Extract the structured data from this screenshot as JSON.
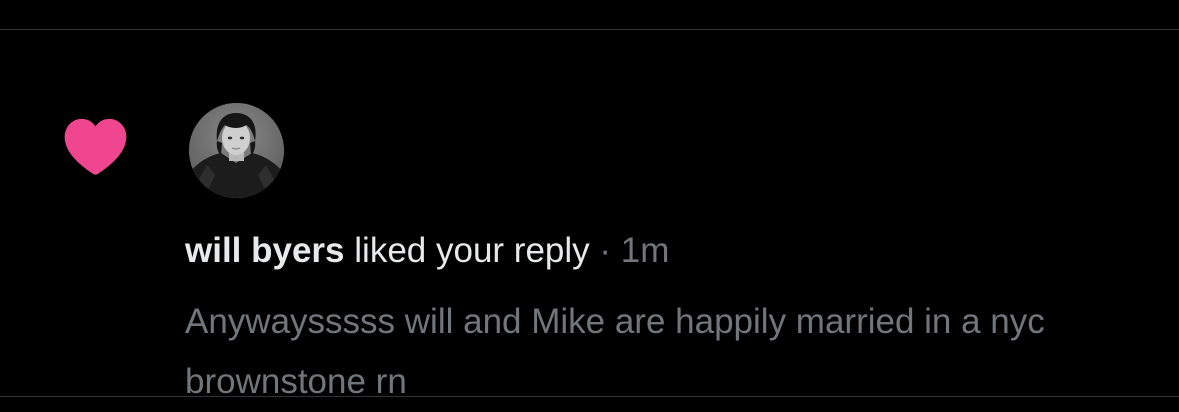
{
  "notification": {
    "icon": "heart-icon",
    "icon_color": "#f91880",
    "user": {
      "display_name": "will byers",
      "avatar": "user-avatar"
    },
    "action_text": "liked your reply",
    "separator": "·",
    "timestamp": "1m",
    "reply_text": "Anywaysssss will and Mike are happily married in a nyc brownstone rn"
  },
  "colors": {
    "background": "#000000",
    "primary_text": "#e7e9ea",
    "secondary_text": "#71767b",
    "divider": "#2f3336"
  }
}
